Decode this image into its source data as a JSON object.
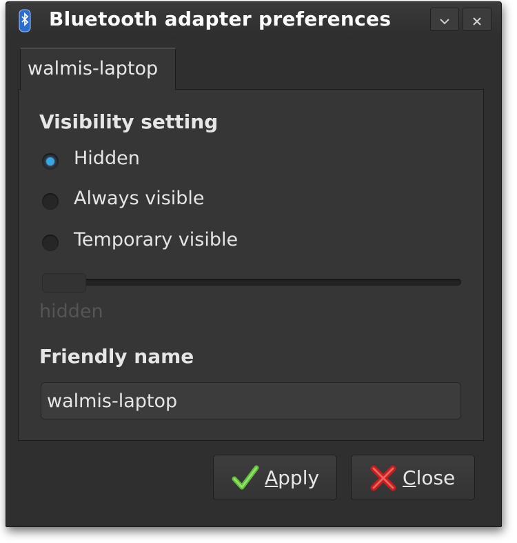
{
  "window": {
    "title": "Bluetooth adapter preferences",
    "app_icon": "bluetooth-icon",
    "buttons": {
      "minimize_icon": "chevron-down-icon",
      "close_icon": "close-icon"
    }
  },
  "tabs": [
    {
      "label": "walmis-laptop",
      "active": true
    }
  ],
  "visibility": {
    "heading": "Visibility setting",
    "options": [
      {
        "label": "Hidden",
        "checked": true
      },
      {
        "label": "Always visible",
        "checked": false
      },
      {
        "label": "Temporary visible",
        "checked": false
      }
    ],
    "timeout": {
      "value_text": "hidden",
      "fraction": 0
    }
  },
  "friendly_name": {
    "heading": "Friendly name",
    "value": "walmis-laptop"
  },
  "actions": {
    "apply": {
      "mnemonic": "A",
      "rest": "pply",
      "icon": "check-icon"
    },
    "close": {
      "mnemonic": "C",
      "rest": "lose",
      "icon": "red-x-icon"
    }
  },
  "colors": {
    "accent": "#3aa6e0",
    "background": "#2f2f2f",
    "text": "#e4e4e4"
  }
}
